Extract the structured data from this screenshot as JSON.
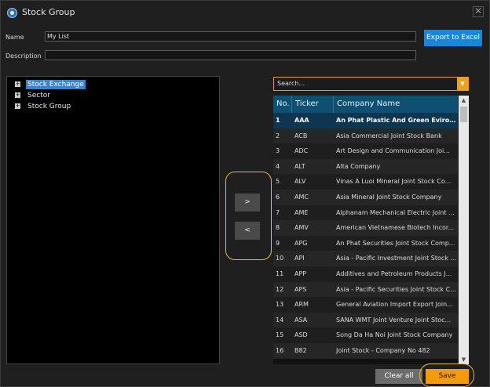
{
  "window": {
    "title": "Stock Group",
    "close_glyph": "✕"
  },
  "form": {
    "name_label": "Name",
    "name_value": "My List",
    "description_label": "Description",
    "description_value": "",
    "export_label": "Export to Excel"
  },
  "tree": {
    "items": [
      {
        "label": "Stock Exchange",
        "selected": true
      },
      {
        "label": "Sector",
        "selected": false
      },
      {
        "label": "Stock Group",
        "selected": false
      }
    ],
    "expand_glyph": "+"
  },
  "move": {
    "add_label": ">",
    "remove_label": "<"
  },
  "search": {
    "placeholder": "Search...",
    "dropdown_glyph": "▼"
  },
  "grid": {
    "columns": [
      "No.",
      "Ticker",
      "Company Name"
    ],
    "rows": [
      {
        "no": "1",
        "ticker": "AAA",
        "name": "An Phat Plastic And Green Evironme..."
      },
      {
        "no": "2",
        "ticker": "ACB",
        "name": "Asia Commercial Joint Stock Bank"
      },
      {
        "no": "3",
        "ticker": "ADC",
        "name": "Art Design and Communication Joi..."
      },
      {
        "no": "4",
        "ticker": "ALT",
        "name": "Alta Company"
      },
      {
        "no": "5",
        "ticker": "ALV",
        "name": "Vinas A Luoi Mineral Joint Stock Co..."
      },
      {
        "no": "6",
        "ticker": "AMC",
        "name": "Asia Mineral Joint Stock Company"
      },
      {
        "no": "7",
        "ticker": "AME",
        "name": "Alphanam Mechanical Electric Joint ..."
      },
      {
        "no": "8",
        "ticker": "AMV",
        "name": "American Vietnamese Biotech Incor..."
      },
      {
        "no": "9",
        "ticker": "APG",
        "name": "An Phat Securities Joint Stock Comp..."
      },
      {
        "no": "10",
        "ticker": "API",
        "name": "Asia - Pacific Investment Joint Stock ..."
      },
      {
        "no": "11",
        "ticker": "APP",
        "name": "Additives and Petroleum Products J..."
      },
      {
        "no": "12",
        "ticker": "APS",
        "name": "Asia - Pacific Securities Joint Stock C..."
      },
      {
        "no": "13",
        "ticker": "ARM",
        "name": "General Aviation Import Export Join..."
      },
      {
        "no": "14",
        "ticker": "ASA",
        "name": "SANA WMT Joint Venture Joint Stoc..."
      },
      {
        "no": "15",
        "ticker": "ASD",
        "name": "Song Da Ha Noi Joint Stock Company"
      },
      {
        "no": "16",
        "ticker": "B82",
        "name": "Joint Stock - Company No 482"
      }
    ]
  },
  "footer": {
    "clear_label": "Clear all",
    "save_label": "Save"
  },
  "scroll": {
    "up_glyph": "▲",
    "down_glyph": "▼"
  },
  "colors": {
    "accent": "#f29a10",
    "export": "#1a86d9",
    "highlight_ring": "#e6bb3c",
    "header": "#0f4f72"
  }
}
